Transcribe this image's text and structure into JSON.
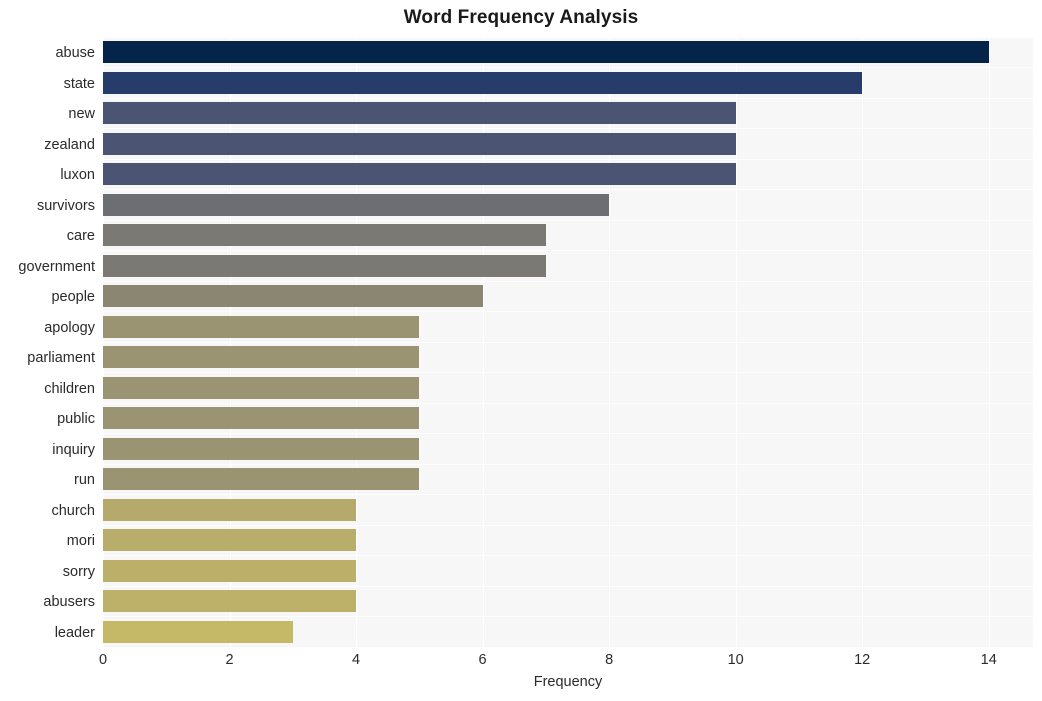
{
  "chart_data": {
    "type": "bar",
    "orientation": "horizontal",
    "title": "Word Frequency Analysis",
    "xlabel": "Frequency",
    "ylabel": "",
    "xlim": [
      0,
      14.7
    ],
    "ylim": [
      0,
      20
    ],
    "grid": true,
    "legend": null,
    "xticks": [
      0,
      2,
      4,
      6,
      8,
      10,
      12,
      14
    ],
    "xtick_labels": [
      "0",
      "2",
      "4",
      "6",
      "8",
      "10",
      "12",
      "14"
    ],
    "categories": [
      "abuse",
      "state",
      "new",
      "zealand",
      "luxon",
      "survivors",
      "care",
      "government",
      "people",
      "apology",
      "parliament",
      "children",
      "public",
      "inquiry",
      "run",
      "church",
      "mori",
      "sorry",
      "abusers",
      "leader"
    ],
    "values": [
      14,
      12,
      10,
      10,
      10,
      8,
      7,
      7,
      6,
      5,
      5,
      5,
      5,
      5,
      5,
      4,
      4,
      4,
      4,
      3
    ],
    "bar_colors": [
      "#042449",
      "#263d6b",
      "#4b5472",
      "#4b5472",
      "#4b5472",
      "#6c6e74",
      "#7b7973",
      "#7b7973",
      "#8b8672",
      "#9b9472",
      "#9b9472",
      "#9b9472",
      "#9b9472",
      "#9b9472",
      "#9b9472",
      "#b5a96c",
      "#b8ad6b",
      "#bbaf6a",
      "#bdb169",
      "#c5b866"
    ],
    "plot_background": "#f7f7f7",
    "gridline_color": "#ffffff",
    "page_background": "#ffffff"
  }
}
